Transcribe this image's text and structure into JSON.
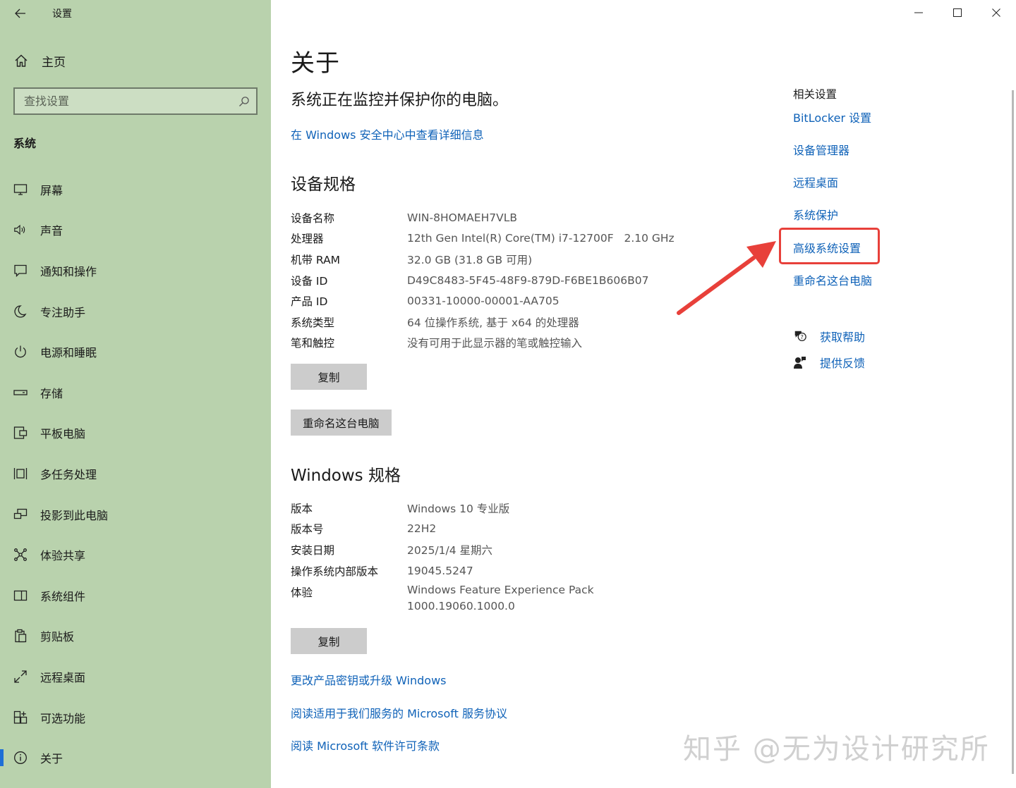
{
  "window": {
    "title": "设置"
  },
  "sidebar": {
    "home_label": "主页",
    "search_placeholder": "查找设置",
    "section_label": "系统",
    "items": [
      {
        "label": "屏幕",
        "icon": "monitor-icon"
      },
      {
        "label": "声音",
        "icon": "speaker-icon"
      },
      {
        "label": "通知和操作",
        "icon": "message-icon"
      },
      {
        "label": "专注助手",
        "icon": "moon-icon"
      },
      {
        "label": "电源和睡眠",
        "icon": "power-icon"
      },
      {
        "label": "存储",
        "icon": "storage-icon"
      },
      {
        "label": "平板电脑",
        "icon": "tablet-icon"
      },
      {
        "label": "多任务处理",
        "icon": "multitask-icon"
      },
      {
        "label": "投影到此电脑",
        "icon": "project-icon"
      },
      {
        "label": "体验共享",
        "icon": "share-icon"
      },
      {
        "label": "系统组件",
        "icon": "components-icon"
      },
      {
        "label": "剪贴板",
        "icon": "clipboard-icon"
      },
      {
        "label": "远程桌面",
        "icon": "remote-icon"
      },
      {
        "label": "可选功能",
        "icon": "features-icon"
      },
      {
        "label": "关于",
        "icon": "info-icon",
        "active": true
      }
    ]
  },
  "main": {
    "title": "关于",
    "security_message": "系统正在监控并保护你的电脑。",
    "security_link": "在 Windows 安全中心中查看详细信息",
    "device_specs": {
      "heading": "设备规格",
      "rows": [
        {
          "key": "设备名称",
          "value": "WIN-8HOMAEH7VLB"
        },
        {
          "key": "处理器",
          "value": "12th Gen Intel(R) Core(TM) i7-12700F   2.10 GHz"
        },
        {
          "key": "机带 RAM",
          "value": "32.0 GB (31.8 GB 可用)"
        },
        {
          "key": "设备 ID",
          "value": "D49C8483-5F45-48F9-879D-F6BE1B606B07"
        },
        {
          "key": "产品 ID",
          "value": "00331-10000-00001-AA705"
        },
        {
          "key": "系统类型",
          "value": "64 位操作系统, 基于 x64 的处理器"
        },
        {
          "key": "笔和触控",
          "value": "没有可用于此显示器的笔或触控输入"
        }
      ],
      "copy_button": "复制",
      "rename_button": "重命名这台电脑"
    },
    "windows_specs": {
      "heading": "Windows 规格",
      "rows": [
        {
          "key": "版本",
          "value": "Windows 10 专业版"
        },
        {
          "key": "版本号",
          "value": "22H2"
        },
        {
          "key": "安装日期",
          "value": "2025/1/4 星期六"
        },
        {
          "key": "操作系统内部版本",
          "value": "19045.5247"
        },
        {
          "key": "体验",
          "value": "Windows Feature Experience Pack",
          "value2": "1000.19060.1000.0"
        }
      ],
      "copy_button": "复制"
    },
    "links": [
      "更改产品密钥或升级 Windows",
      "阅读适用于我们服务的 Microsoft 服务协议",
      "阅读 Microsoft 软件许可条款"
    ]
  },
  "related": {
    "heading": "相关设置",
    "links": [
      "BitLocker 设置",
      "设备管理器",
      "远程桌面",
      "系统保护",
      "高级系统设置",
      "重命名这台电脑"
    ],
    "help_label": "获取帮助",
    "feedback_label": "提供反馈"
  },
  "watermark": "知乎 @无为设计研究所",
  "colors": {
    "sidebar_bg": "#b9d2ad",
    "link": "#0f62b8",
    "highlight": "#e8403a",
    "active_indicator": "#1e6fd6",
    "button_bg": "#cccccc"
  }
}
